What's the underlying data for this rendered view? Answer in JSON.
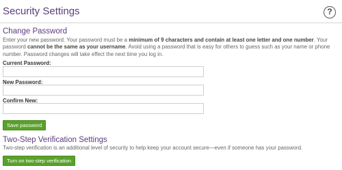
{
  "page": {
    "title": "Security Settings",
    "help_glyph": "?"
  },
  "change_password": {
    "heading": "Change Password",
    "description": {
      "p1": "Enter your new password. Your password must be a ",
      "b1": "minimum of 9 characters and contain at least one letter and one number",
      "p2": ". Your password ",
      "b2": "cannot be the same as your username",
      "p3": ". Avoid using a password that is easy for others to guess such as your name or phone number. Password changes will take effect the next time you log in."
    },
    "fields": [
      {
        "label": "Current Password:",
        "value": "",
        "placeholder": ""
      },
      {
        "label": "New Password:",
        "value": "",
        "placeholder": ""
      },
      {
        "label": "Confirm New:",
        "value": "",
        "placeholder": ""
      }
    ],
    "save_label": "Save password"
  },
  "two_step": {
    "heading": "Two-Step Verification Settings",
    "description": "Two-step verification is an additional level of security to help keep your account secure—even if someone has your password.",
    "button_label": "Turn on two-step verification"
  },
  "colors": {
    "heading": "#5c3b7e",
    "button": "#5aa12b",
    "text": "#666666"
  },
  "icons": {
    "help": "help-icon"
  }
}
